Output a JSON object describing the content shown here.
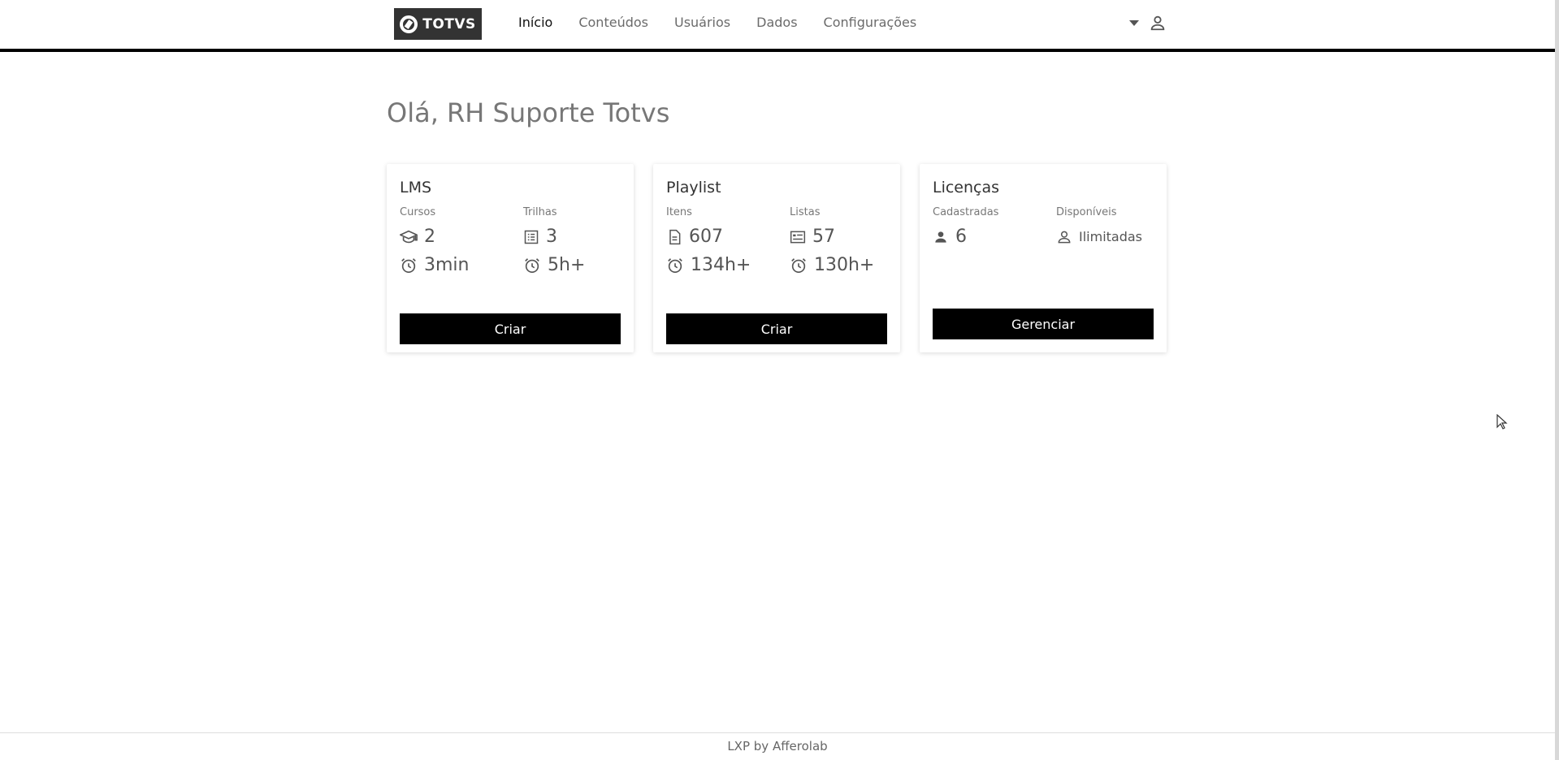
{
  "header": {
    "logo_text": "TOTVS",
    "nav": [
      {
        "label": "Início",
        "active": true
      },
      {
        "label": "Conteúdos",
        "active": false
      },
      {
        "label": "Usuários",
        "active": false
      },
      {
        "label": "Dados",
        "active": false
      },
      {
        "label": "Configurações",
        "active": false
      }
    ],
    "icons": [
      "dropdown-caret-icon",
      "user-icon"
    ]
  },
  "main": {
    "greeting": "Olá, RH Suporte Totvs",
    "cards": [
      {
        "title": "LMS",
        "labels": [
          "Cursos",
          "Trilhas"
        ],
        "stats": [
          {
            "icon": "graduation-cap-icon",
            "value": "2"
          },
          {
            "icon": "list-icon",
            "value": "3"
          },
          {
            "icon": "alarm-clock-icon",
            "value": "3min"
          },
          {
            "icon": "alarm-clock-icon",
            "value": "5h+"
          }
        ],
        "button": "Criar"
      },
      {
        "title": "Playlist",
        "labels": [
          "Itens",
          "Listas"
        ],
        "stats": [
          {
            "icon": "document-icon",
            "value": "607"
          },
          {
            "icon": "checklist-icon",
            "value": "57"
          },
          {
            "icon": "alarm-clock-icon",
            "value": "134h+"
          },
          {
            "icon": "alarm-clock-icon",
            "value": "130h+"
          }
        ],
        "button": "Criar"
      },
      {
        "title": "Licenças",
        "labels": [
          "Cadastradas",
          "Disponíveis"
        ],
        "stats": [
          {
            "icon": "person-filled-icon",
            "value": "6"
          },
          {
            "icon": "person-outline-icon",
            "value": "Ilimitadas"
          }
        ],
        "button": "Gerenciar"
      }
    ]
  },
  "footer": {
    "text": "LXP by Afferolab"
  },
  "colors": {
    "accent": "#000000",
    "logo_bg": "#333333",
    "muted_text": "#777777"
  }
}
